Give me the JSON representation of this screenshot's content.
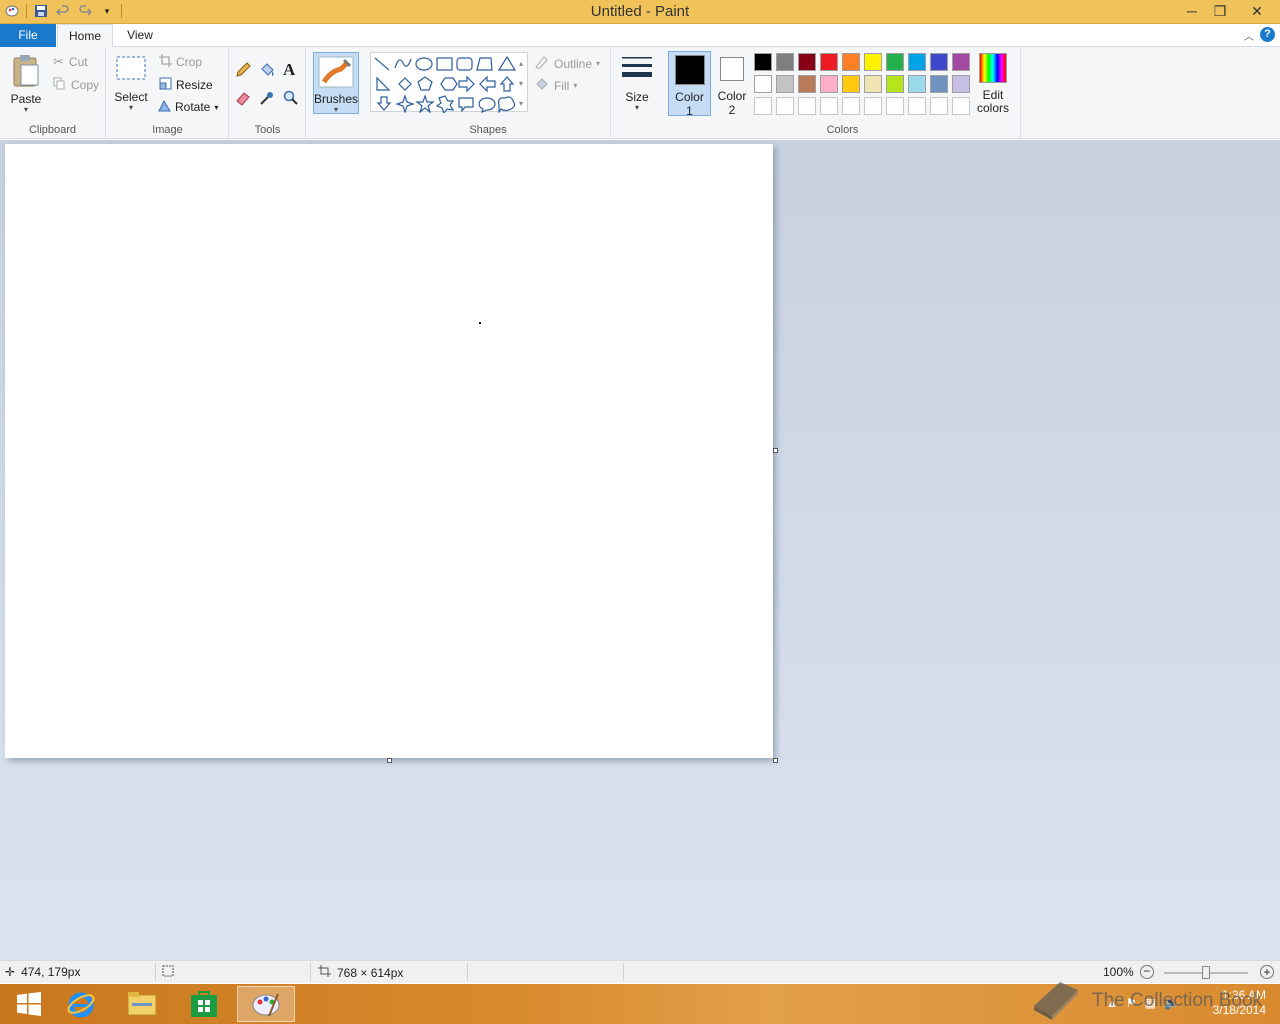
{
  "window": {
    "title": "Untitled - Paint"
  },
  "tabs": {
    "file": "File",
    "home": "Home",
    "view": "View"
  },
  "clipboard": {
    "paste": "Paste",
    "cut": "Cut",
    "copy": "Copy",
    "group": "Clipboard"
  },
  "image": {
    "select": "Select",
    "crop": "Crop",
    "resize": "Resize",
    "rotate": "Rotate",
    "group": "Image"
  },
  "tools": {
    "group": "Tools"
  },
  "brushes": {
    "label": "Brushes"
  },
  "shapes": {
    "outline": "Outline",
    "fill": "Fill",
    "group": "Shapes"
  },
  "size": {
    "label": "Size"
  },
  "colors": {
    "color1_line1": "Color",
    "color1_line2": "1",
    "color2_line1": "Color",
    "color2_line2": "2",
    "edit_line1": "Edit",
    "edit_line2": "colors",
    "group": "Colors",
    "color1_value": "#000000",
    "color2_value": "#ffffff",
    "palette_row1": [
      "#000000",
      "#7f7f7f",
      "#880015",
      "#ed1c24",
      "#ff7f27",
      "#fff200",
      "#22b14c",
      "#00a2e8",
      "#3f48cc",
      "#a349a4"
    ],
    "palette_row2": [
      "#ffffff",
      "#c3c3c3",
      "#b97a57",
      "#ffaec9",
      "#ffc90e",
      "#efe4b0",
      "#b5e61d",
      "#99d9ea",
      "#7092be",
      "#c8bfe7"
    ],
    "palette_row3": [
      "#ffffff",
      "#ffffff",
      "#ffffff",
      "#ffffff",
      "#ffffff",
      "#ffffff",
      "#ffffff",
      "#ffffff",
      "#ffffff",
      "#ffffff"
    ]
  },
  "status": {
    "position": "474, 179px",
    "dimensions": "768 × 614px",
    "zoom": "100%"
  },
  "taskbar": {
    "time": "1:36 AM",
    "date": "3/18/2014"
  },
  "watermark": {
    "text": "The Collection Book"
  }
}
